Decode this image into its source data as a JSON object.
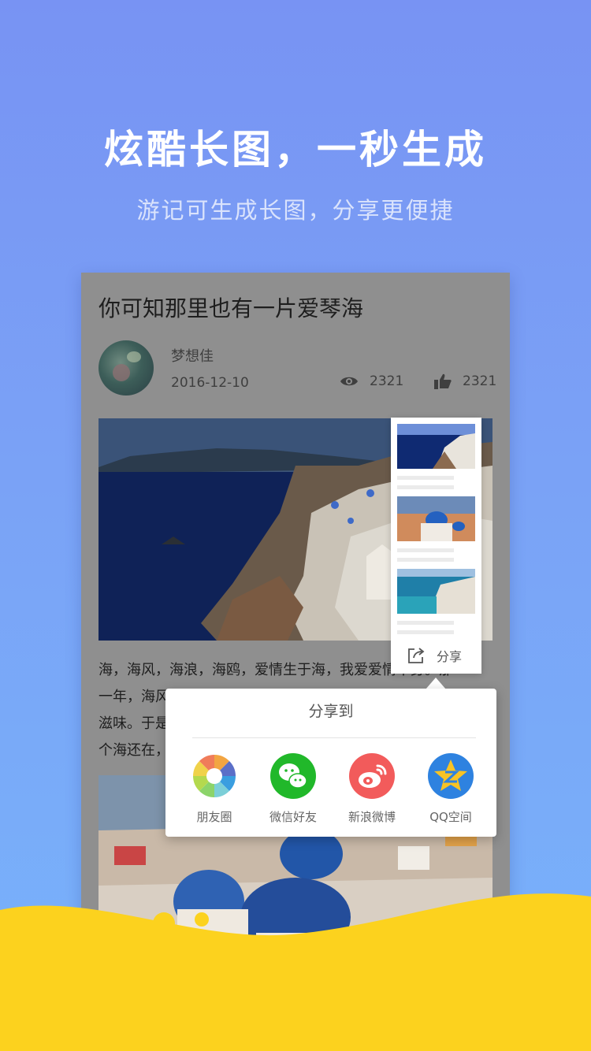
{
  "hero": {
    "title": "炫酷长图，一秒生成",
    "subtitle": "游记可生成长图，分享更便捷"
  },
  "article": {
    "title": "你可知那里也有一片爱琴海",
    "author": "梦想佳",
    "date": "2016-12-10",
    "views": "2321",
    "likes": "2321",
    "body": "海，海风，海浪，海鸥，爱情生于海，我爱爱情本身。那一年，海风... 滋味。于是... 个海还在..."
  },
  "preview": {
    "share_label": "分享"
  },
  "share_sheet": {
    "title": "分享到",
    "options": [
      {
        "label": "朋友圈",
        "icon": "moments-icon",
        "color": "#f2a542"
      },
      {
        "label": "微信好友",
        "icon": "wechat-icon",
        "color": "#21b82a"
      },
      {
        "label": "新浪微博",
        "icon": "weibo-icon",
        "color": "#f25b5b"
      },
      {
        "label": "QQ空间",
        "icon": "qzone-icon",
        "color": "#2e82e0"
      }
    ]
  },
  "pager": {
    "total": 2,
    "active_index": 0
  },
  "colors": {
    "background_top": "#7893f3",
    "background_bottom": "#78b3fb",
    "accent_yellow": "#fcd21e"
  }
}
